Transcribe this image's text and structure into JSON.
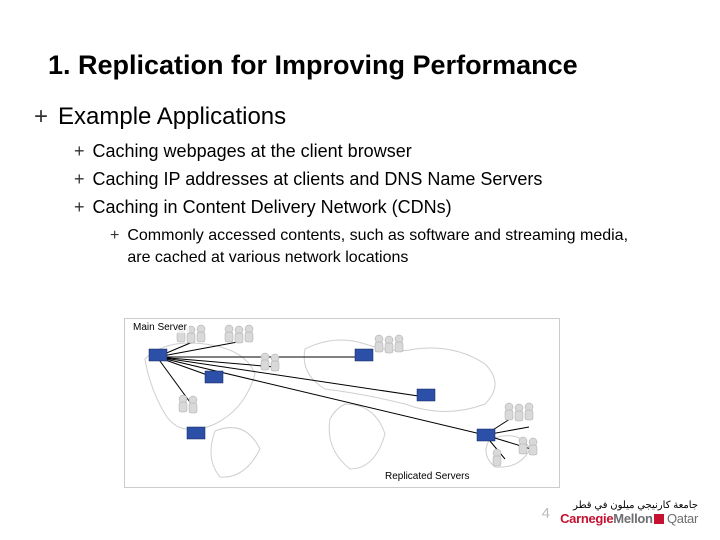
{
  "title": "1. Replication for Improving Performance",
  "bullet_mark": "+",
  "lvl1": {
    "text": "Example Applications"
  },
  "lvl2": {
    "a": "Caching webpages at the client browser",
    "b": "Caching IP addresses at clients and DNS Name Servers",
    "c": "Caching in Content Delivery Network (CDNs)"
  },
  "lvl3": {
    "a": "Commonly accessed contents, such as software and streaming media, are cached at various network locations"
  },
  "figure": {
    "main_label": "Main Server",
    "replicated_label": "Replicated Servers"
  },
  "page_number": "4",
  "logo": {
    "arabic": "جامعة كارنيجي ميلون في قطر",
    "carnegie": "Carnegie",
    "mellon": "Mellon",
    "qatar": "Qatar"
  }
}
